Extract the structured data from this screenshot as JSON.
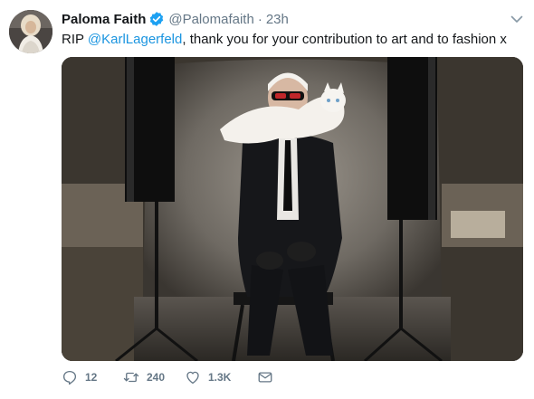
{
  "tweet": {
    "author_name": "Paloma Faith",
    "author_handle": "@Palomafaith",
    "separator": "·",
    "time": "23h",
    "text_prefix": "RIP ",
    "mention": "@KarlLagerfeld",
    "text_suffix": ", thank you for your contribution to art and to fashion x",
    "replies": "12",
    "retweets": "240",
    "likes": "1.3K"
  },
  "icons": {
    "verified": "verified-badge-icon",
    "menu": "chevron-down-icon",
    "reply": "reply-icon",
    "retweet": "retweet-icon",
    "like": "heart-icon",
    "dm": "envelope-icon"
  },
  "colors": {
    "link": "#1b95e0",
    "secondary_text": "#657786",
    "verified_badge": "#1da1f2"
  }
}
